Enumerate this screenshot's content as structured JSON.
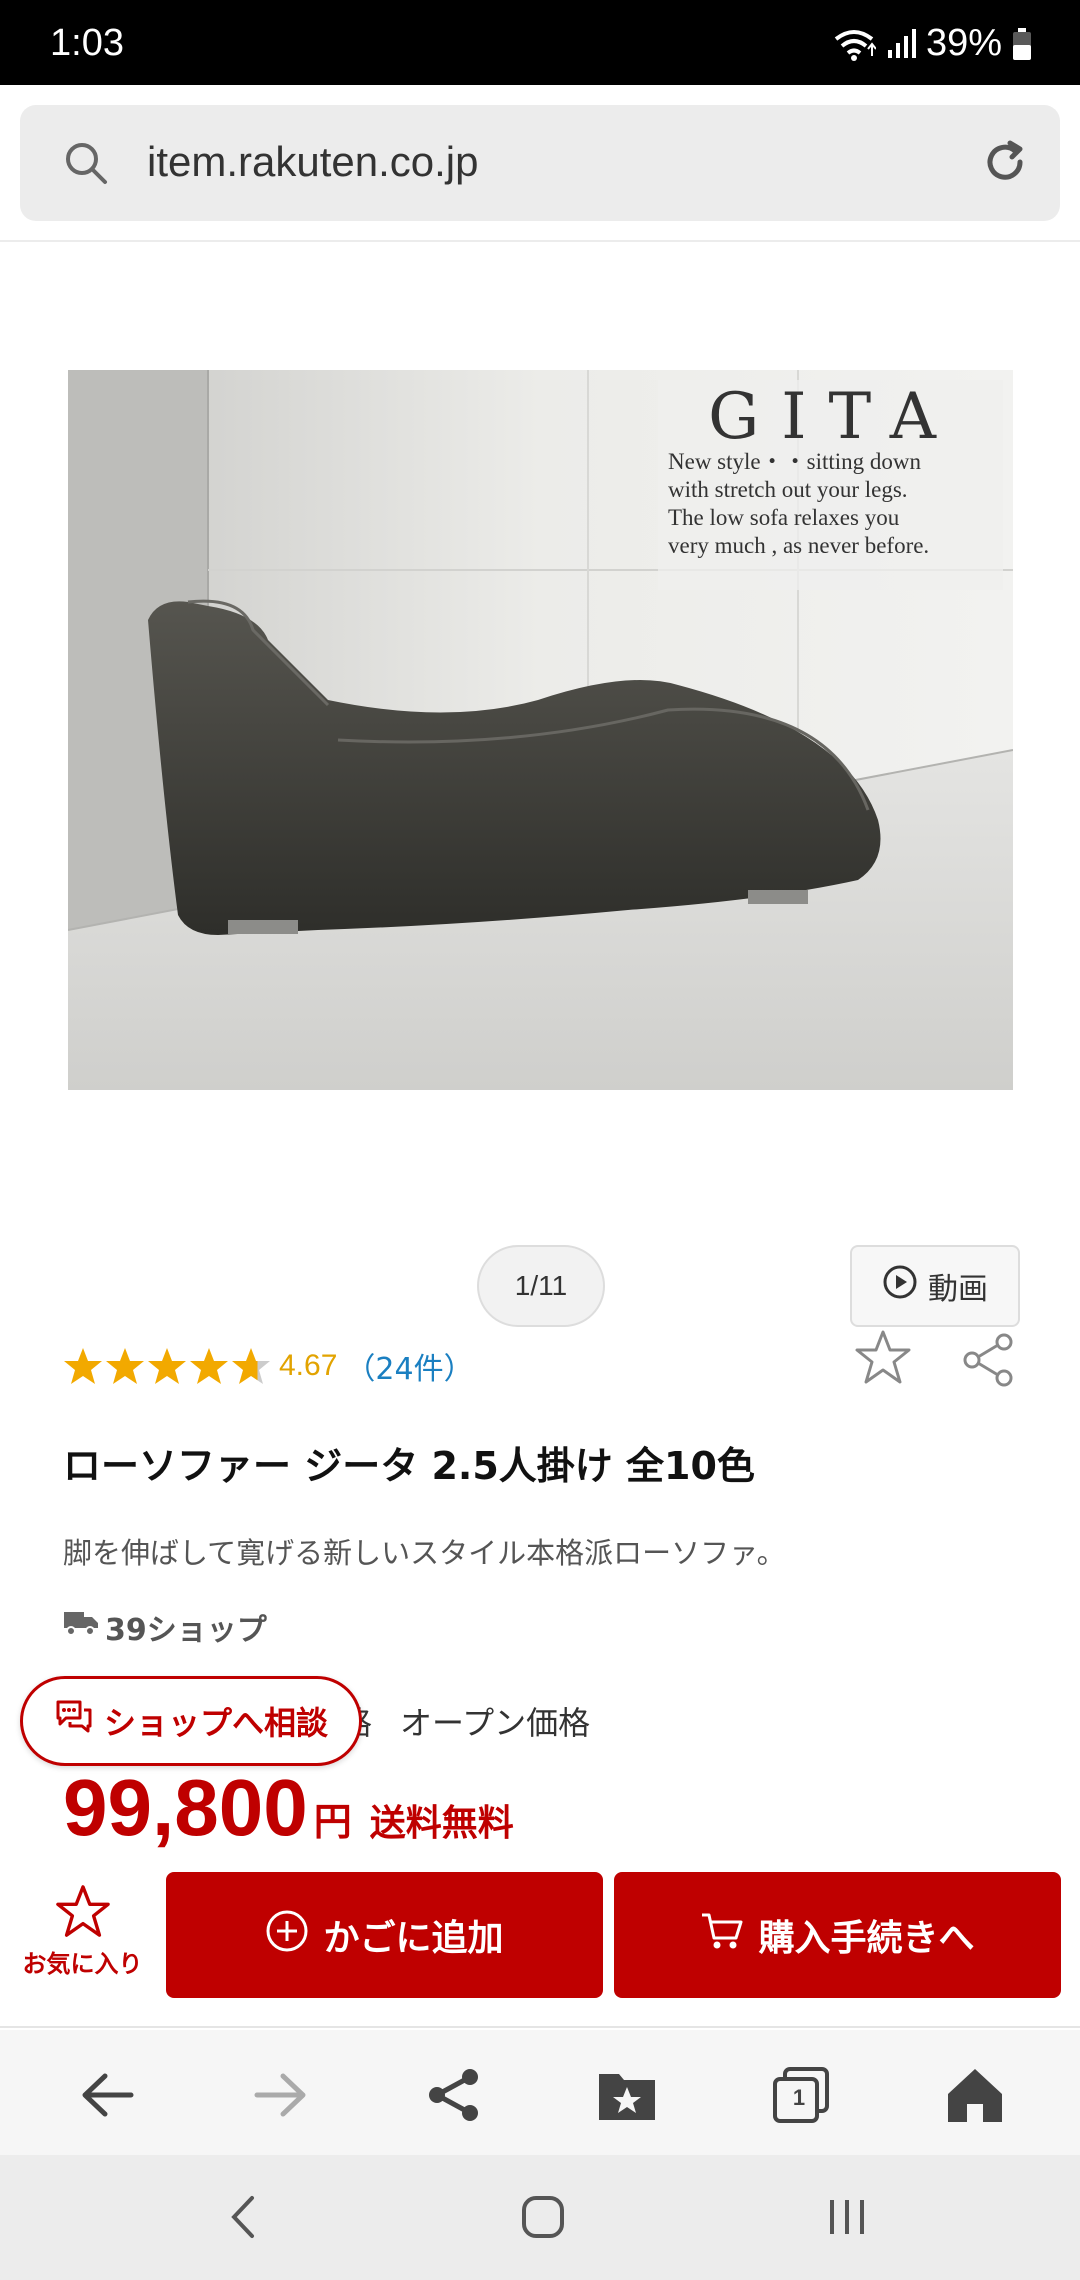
{
  "status_bar": {
    "time": "1:03",
    "battery": "39%"
  },
  "url_bar": {
    "url": "item.rakuten.co.jp"
  },
  "product_image": {
    "brand_title": "GITA",
    "caption_lines": [
      "New style・・sitting down",
      "with stretch out your legs.",
      "The low sofa relaxes you",
      "very much , as never before."
    ]
  },
  "gallery": {
    "pager": "1/11",
    "video_label": "動画"
  },
  "rating": {
    "value": "4.67",
    "score": 4.67,
    "max": 5,
    "count_text": "（24件）",
    "star_color": "#f2a900"
  },
  "product": {
    "title": "ローソファー ジータ 2.5人掛け 全10色",
    "description": "脚を伸ばして寛げる新しいスタイル本格派ローソファ。",
    "shipping": "39ショップ",
    "price_label_fragment": "格",
    "price_label_value": "オープン価格",
    "price": "99,800",
    "currency": "円",
    "shipping_free": "送料無料"
  },
  "consult_button": {
    "label": "ショップへ相談"
  },
  "actions": {
    "favorite_label": "お気に入り",
    "add_to_cart": "かごに追加",
    "checkout": "購入手続きへ"
  },
  "browser_nav": {
    "tab_count": "1"
  },
  "colors": {
    "accent_red": "#bf0000",
    "link_blue": "#1a7fc1",
    "rating_gold": "#e2a300"
  }
}
